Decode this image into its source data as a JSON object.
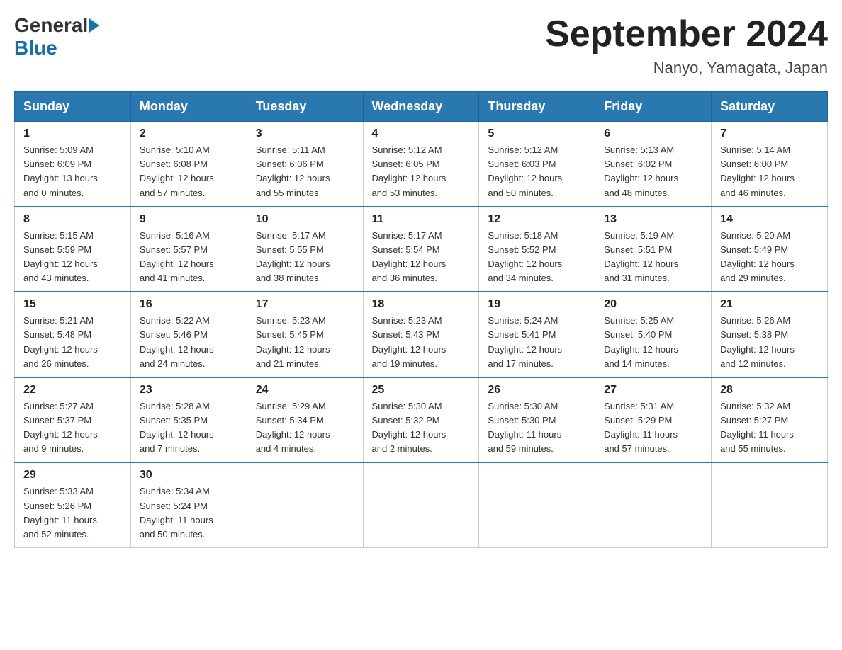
{
  "header": {
    "logo_general": "General",
    "logo_blue": "Blue",
    "month_title": "September 2024",
    "location": "Nanyo, Yamagata, Japan"
  },
  "weekdays": [
    "Sunday",
    "Monday",
    "Tuesday",
    "Wednesday",
    "Thursday",
    "Friday",
    "Saturday"
  ],
  "weeks": [
    [
      {
        "day": "1",
        "sunrise": "5:09 AM",
        "sunset": "6:09 PM",
        "daylight": "13 hours and 0 minutes."
      },
      {
        "day": "2",
        "sunrise": "5:10 AM",
        "sunset": "6:08 PM",
        "daylight": "12 hours and 57 minutes."
      },
      {
        "day": "3",
        "sunrise": "5:11 AM",
        "sunset": "6:06 PM",
        "daylight": "12 hours and 55 minutes."
      },
      {
        "day": "4",
        "sunrise": "5:12 AM",
        "sunset": "6:05 PM",
        "daylight": "12 hours and 53 minutes."
      },
      {
        "day": "5",
        "sunrise": "5:12 AM",
        "sunset": "6:03 PM",
        "daylight": "12 hours and 50 minutes."
      },
      {
        "day": "6",
        "sunrise": "5:13 AM",
        "sunset": "6:02 PM",
        "daylight": "12 hours and 48 minutes."
      },
      {
        "day": "7",
        "sunrise": "5:14 AM",
        "sunset": "6:00 PM",
        "daylight": "12 hours and 46 minutes."
      }
    ],
    [
      {
        "day": "8",
        "sunrise": "5:15 AM",
        "sunset": "5:59 PM",
        "daylight": "12 hours and 43 minutes."
      },
      {
        "day": "9",
        "sunrise": "5:16 AM",
        "sunset": "5:57 PM",
        "daylight": "12 hours and 41 minutes."
      },
      {
        "day": "10",
        "sunrise": "5:17 AM",
        "sunset": "5:55 PM",
        "daylight": "12 hours and 38 minutes."
      },
      {
        "day": "11",
        "sunrise": "5:17 AM",
        "sunset": "5:54 PM",
        "daylight": "12 hours and 36 minutes."
      },
      {
        "day": "12",
        "sunrise": "5:18 AM",
        "sunset": "5:52 PM",
        "daylight": "12 hours and 34 minutes."
      },
      {
        "day": "13",
        "sunrise": "5:19 AM",
        "sunset": "5:51 PM",
        "daylight": "12 hours and 31 minutes."
      },
      {
        "day": "14",
        "sunrise": "5:20 AM",
        "sunset": "5:49 PM",
        "daylight": "12 hours and 29 minutes."
      }
    ],
    [
      {
        "day": "15",
        "sunrise": "5:21 AM",
        "sunset": "5:48 PM",
        "daylight": "12 hours and 26 minutes."
      },
      {
        "day": "16",
        "sunrise": "5:22 AM",
        "sunset": "5:46 PM",
        "daylight": "12 hours and 24 minutes."
      },
      {
        "day": "17",
        "sunrise": "5:23 AM",
        "sunset": "5:45 PM",
        "daylight": "12 hours and 21 minutes."
      },
      {
        "day": "18",
        "sunrise": "5:23 AM",
        "sunset": "5:43 PM",
        "daylight": "12 hours and 19 minutes."
      },
      {
        "day": "19",
        "sunrise": "5:24 AM",
        "sunset": "5:41 PM",
        "daylight": "12 hours and 17 minutes."
      },
      {
        "day": "20",
        "sunrise": "5:25 AM",
        "sunset": "5:40 PM",
        "daylight": "12 hours and 14 minutes."
      },
      {
        "day": "21",
        "sunrise": "5:26 AM",
        "sunset": "5:38 PM",
        "daylight": "12 hours and 12 minutes."
      }
    ],
    [
      {
        "day": "22",
        "sunrise": "5:27 AM",
        "sunset": "5:37 PM",
        "daylight": "12 hours and 9 minutes."
      },
      {
        "day": "23",
        "sunrise": "5:28 AM",
        "sunset": "5:35 PM",
        "daylight": "12 hours and 7 minutes."
      },
      {
        "day": "24",
        "sunrise": "5:29 AM",
        "sunset": "5:34 PM",
        "daylight": "12 hours and 4 minutes."
      },
      {
        "day": "25",
        "sunrise": "5:30 AM",
        "sunset": "5:32 PM",
        "daylight": "12 hours and 2 minutes."
      },
      {
        "day": "26",
        "sunrise": "5:30 AM",
        "sunset": "5:30 PM",
        "daylight": "11 hours and 59 minutes."
      },
      {
        "day": "27",
        "sunrise": "5:31 AM",
        "sunset": "5:29 PM",
        "daylight": "11 hours and 57 minutes."
      },
      {
        "day": "28",
        "sunrise": "5:32 AM",
        "sunset": "5:27 PM",
        "daylight": "11 hours and 55 minutes."
      }
    ],
    [
      {
        "day": "29",
        "sunrise": "5:33 AM",
        "sunset": "5:26 PM",
        "daylight": "11 hours and 52 minutes."
      },
      {
        "day": "30",
        "sunrise": "5:34 AM",
        "sunset": "5:24 PM",
        "daylight": "11 hours and 50 minutes."
      },
      null,
      null,
      null,
      null,
      null
    ]
  ]
}
